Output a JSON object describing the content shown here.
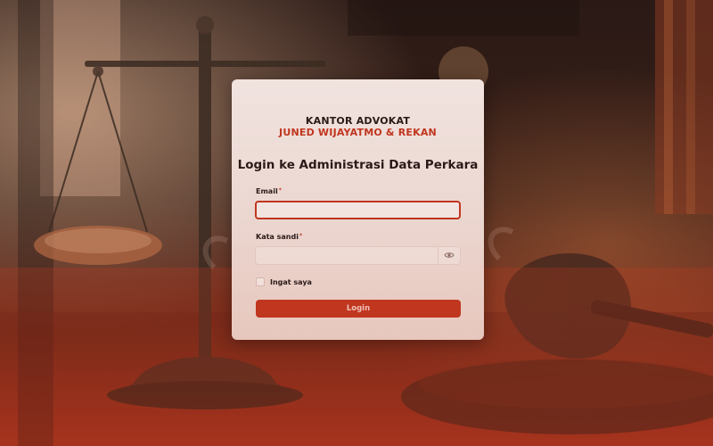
{
  "brand": {
    "line1": "KANTOR ADVOKAT",
    "line2": "JUNED WIJAYATMO & REKAN"
  },
  "login": {
    "title": "Login ke Administrasi Data Perkara",
    "email": {
      "label": "Email",
      "required_marker": "*",
      "value": ""
    },
    "password": {
      "label": "Kata sandi",
      "required_marker": "*",
      "value": ""
    },
    "remember_label": "Ingat saya",
    "submit_label": "Login"
  },
  "icons": {
    "password_toggle": "eye-icon"
  },
  "colors": {
    "accent": "#c0361f",
    "card_bg": "#f1e3df",
    "text_dark": "#2a1a18"
  }
}
